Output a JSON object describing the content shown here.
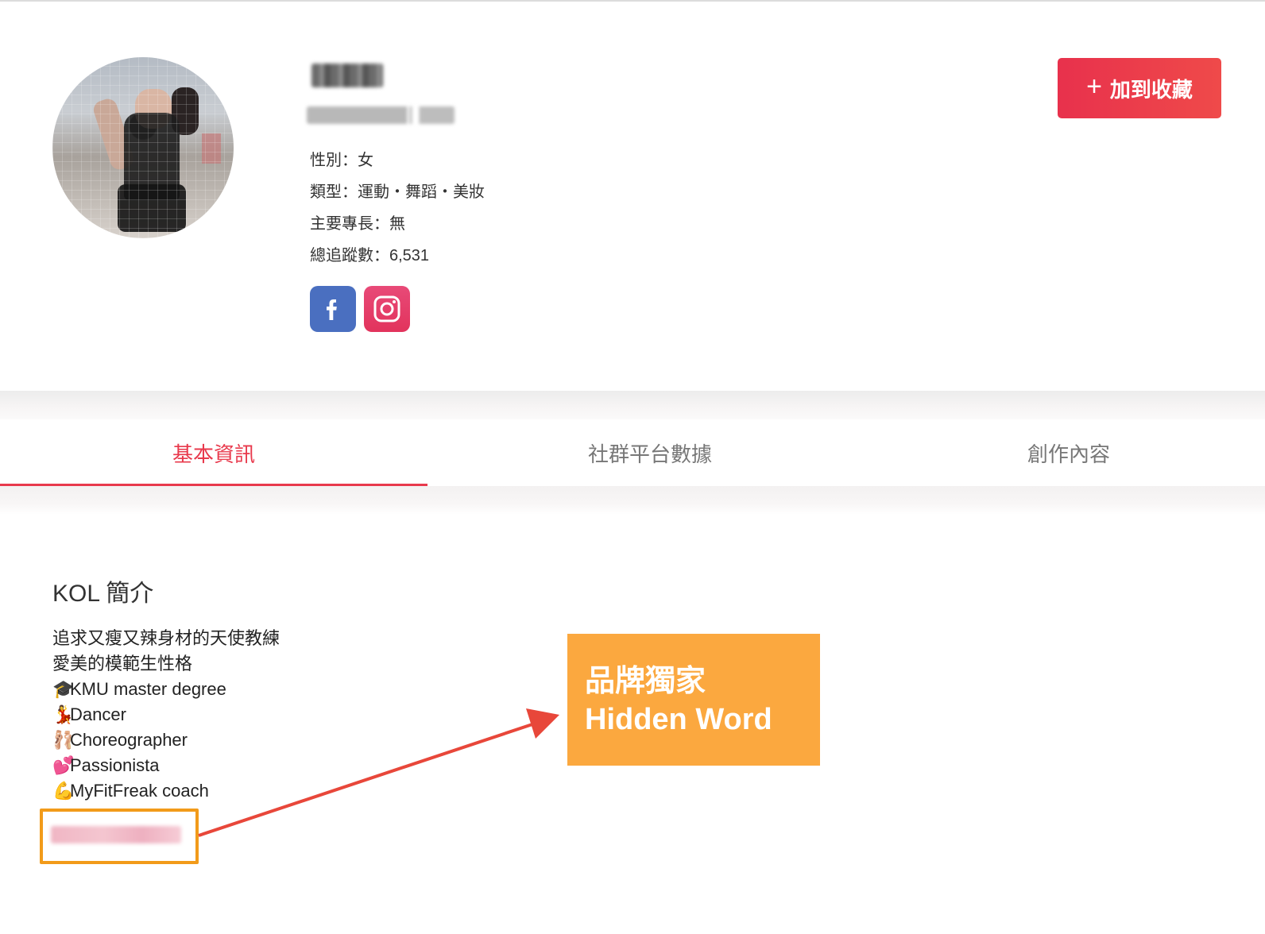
{
  "profile": {
    "gender_label": "性別",
    "gender_value": "女",
    "type_label": "類型",
    "type_value": "運動・舞蹈・美妝",
    "skill_label": "主要專長",
    "skill_value": "無",
    "followers_label": "總追蹤數",
    "followers_value": "6,531"
  },
  "actions": {
    "favorite_label": "加到收藏",
    "favorite_icon": "plus-icon"
  },
  "social": [
    {
      "name": "facebook",
      "icon": "facebook-icon",
      "color": "#4a6fc0"
    },
    {
      "name": "instagram",
      "icon": "instagram-icon",
      "color": "#e2335c"
    }
  ],
  "tabs": [
    {
      "label": "基本資訊",
      "active": true
    },
    {
      "label": "社群平台數據",
      "active": false
    },
    {
      "label": "創作內容",
      "active": false
    }
  ],
  "intro": {
    "title": "KOL 簡介",
    "lines": [
      {
        "emoji": "",
        "text": "追求又瘦又辣身材的天使教練"
      },
      {
        "emoji": "",
        "text": "愛美的模範生性格"
      },
      {
        "emoji": "🎓",
        "text": "KMU master degree"
      },
      {
        "emoji": "💃",
        "text": "Dancer"
      },
      {
        "emoji": "🩰",
        "text": "Choreographer"
      },
      {
        "emoji": "💕",
        "text": "Passionista"
      },
      {
        "emoji": "💪",
        "text": "MyFitFreak coach"
      }
    ]
  },
  "callout": {
    "line1": "品牌獨家",
    "line2": "Hidden Word"
  },
  "colors": {
    "accent": "#e8394c",
    "callout": "#fba83f",
    "highlight": "#f29b1a"
  }
}
